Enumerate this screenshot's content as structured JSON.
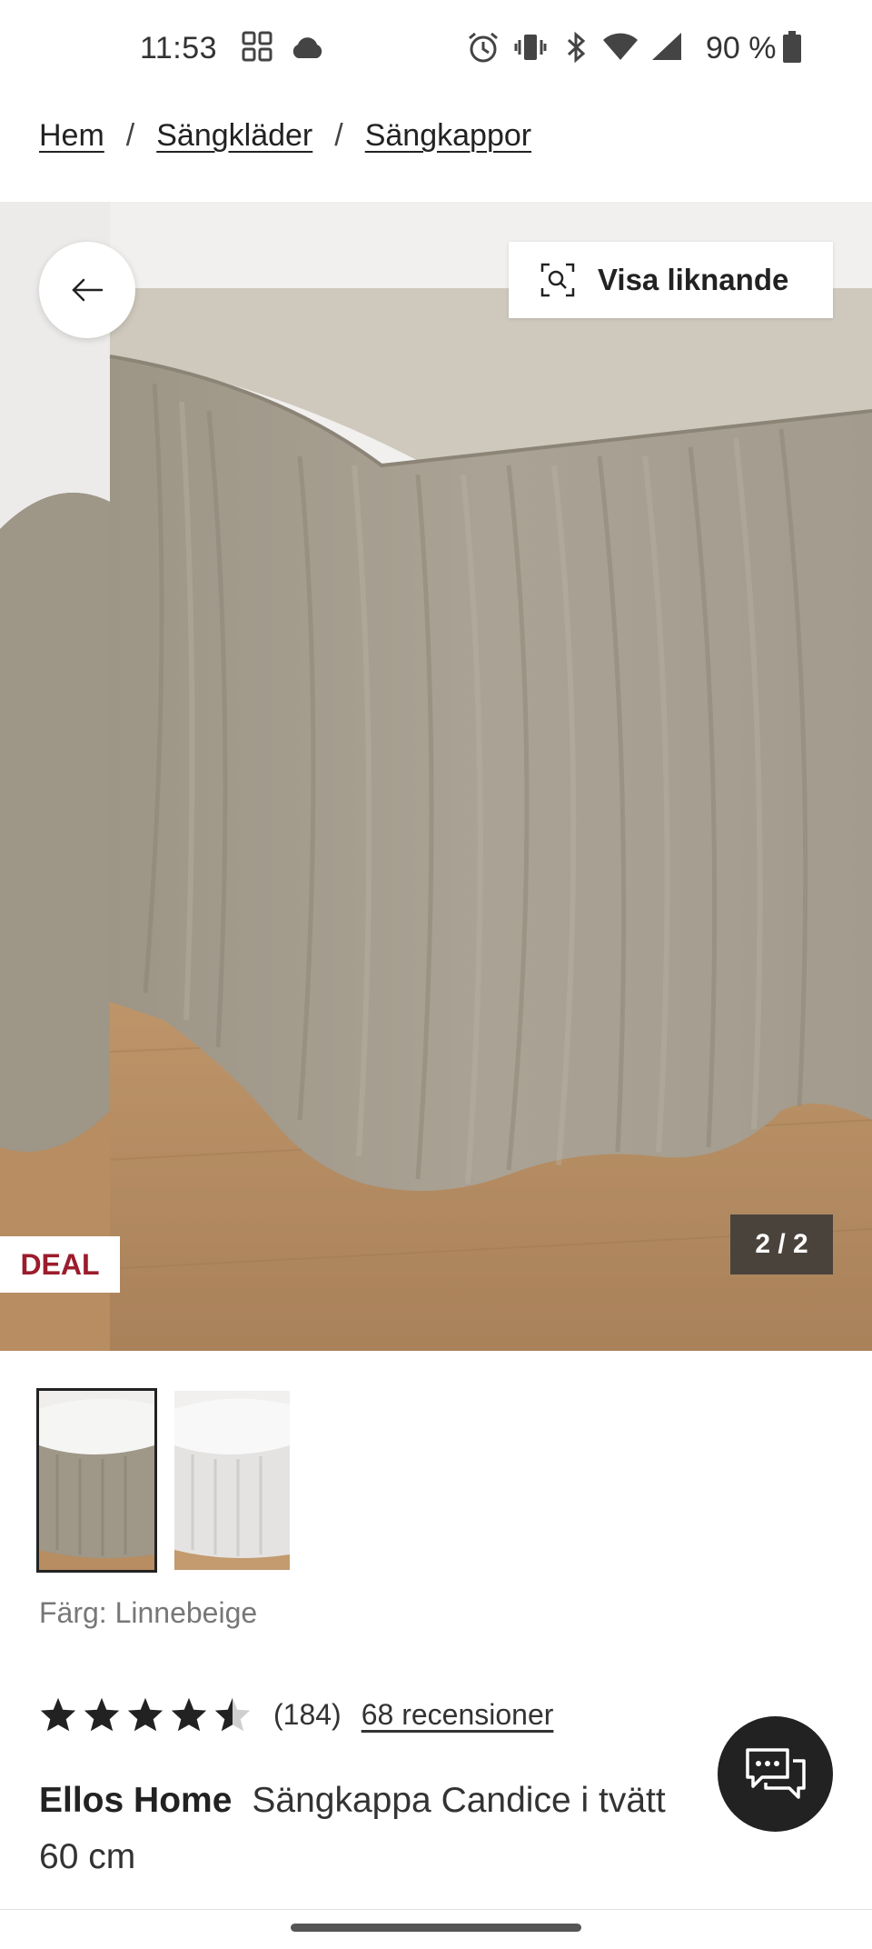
{
  "status_bar": {
    "time": "11:53",
    "battery": "90 %",
    "icons": [
      "grid-icon",
      "cloud-icon",
      "alarm-icon",
      "vibrate-icon",
      "bluetooth-icon",
      "wifi-icon",
      "signal-icon",
      "battery-icon"
    ]
  },
  "breadcrumb": {
    "items": [
      "Hem",
      "Sängkläder",
      "Sängkappor"
    ],
    "separator": "/"
  },
  "gallery": {
    "similar_label": "Visa liknande",
    "deal_badge": "DEAL",
    "counter": "2 / 2"
  },
  "product": {
    "color_line": "Färg: Linnebeige",
    "rating_value": 4.5,
    "rating_count": "(184)",
    "reviews_link": "68 recensioner",
    "brand": "Ellos Home",
    "name": "Sängkappa Candice i tvätt",
    "name_line2": "60 cm"
  },
  "colors": {
    "deal": "#9b1c2c",
    "counter_bg": "#4a433c",
    "fabric": "#a49b8c",
    "floor": "#b48a5e"
  }
}
